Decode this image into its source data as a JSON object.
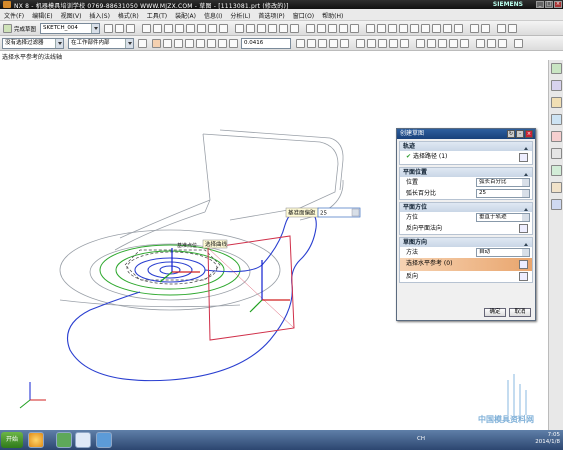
{
  "window": {
    "title": "NX 8 - 机器模具培训学校  0769-88631050  WWW.MJZX.COM - 草图 - [1113081.prt (修改的)]",
    "brand": "SIEMENS"
  },
  "menu": [
    "文件(F)",
    "编辑(E)",
    "视图(V)",
    "插入(S)",
    "格式(R)",
    "工具(T)",
    "装配(A)",
    "信息(I)",
    "分析(L)",
    "首选项(P)",
    "窗口(O)",
    "帮助(H)"
  ],
  "toolbar": {
    "finish_sketch": "完成草图",
    "sketch_name": "SKETCH_004",
    "filter": "没有选择过滤器",
    "scope": "在工作部件内部",
    "value_box": "0.0416"
  },
  "cue_line": "选择水平参考的法线轴",
  "viewport": {
    "dim_label": "基准点位",
    "select_label": "选择曲线",
    "input_label": "基准面偏距",
    "input_value": "25"
  },
  "dialog": {
    "title": "创建草图",
    "sections": [
      {
        "name": "轨迹",
        "rows": [
          {
            "label": "选择路径 (1)",
            "checked": true
          }
        ]
      },
      {
        "name": "平面位置",
        "rows": [
          {
            "label": "位置",
            "value": "弧长百分比"
          },
          {
            "label": "弧长百分比",
            "value": "25"
          }
        ]
      },
      {
        "name": "平面方位",
        "rows": [
          {
            "label": "方位",
            "value": "垂直于轨迹"
          },
          {
            "label": "反向平面法向",
            "value": ""
          }
        ]
      },
      {
        "name": "草图方向",
        "rows": [
          {
            "label": "方法",
            "value": "自动"
          },
          {
            "label": "选择水平参考 (0)",
            "value": ""
          },
          {
            "label": "反向",
            "value": ""
          }
        ]
      }
    ],
    "ok": "确定",
    "cancel": "取消"
  },
  "taskbar": {
    "start": "开始",
    "lang": "CH",
    "time": "7:05",
    "date": "2014/1/8"
  },
  "watermark": "中国模具资料网"
}
